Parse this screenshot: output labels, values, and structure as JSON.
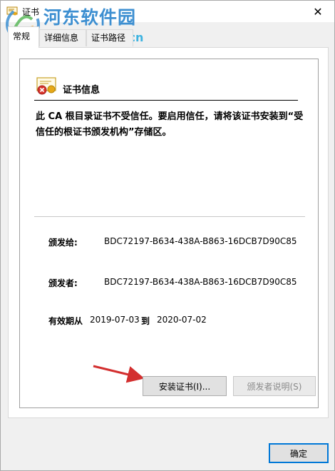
{
  "window": {
    "title": "证书",
    "close_label": "✕"
  },
  "watermark": {
    "main": "河东软件园",
    "sub": "pc0359.cn"
  },
  "tabs": [
    {
      "label": "常规",
      "active": true
    },
    {
      "label": "详细信息",
      "active": false
    },
    {
      "label": "证书路径",
      "active": false
    }
  ],
  "cert_info": {
    "title": "证书信息",
    "warning": "此 CA 根目录证书不受信任。要启用信任，请将该证书安装到“受信任的根证书颁发机构”存储区。"
  },
  "fields": {
    "issued_to_label": "颁发给:",
    "issued_to_value": "BDC72197-B634-438A-B863-16DCB7D90C85",
    "issued_by_label": "颁发者:",
    "issued_by_value": "BDC72197-B634-438A-B863-16DCB7D90C85",
    "valid_from_label": "有效期从",
    "valid_from_value": "2019-07-03",
    "valid_to_label": "到",
    "valid_to_value": "2020-07-02"
  },
  "buttons": {
    "install": "安装证书(I)...",
    "issuer_statement": "颁发者说明(S)",
    "ok": "确定"
  },
  "colors": {
    "accent": "#0078d7",
    "arrow": "#d32f2f",
    "watermark": "#3d8fd1"
  },
  "icons": {
    "title": "certificate-icon",
    "cert_info": "certificate-error-icon"
  }
}
